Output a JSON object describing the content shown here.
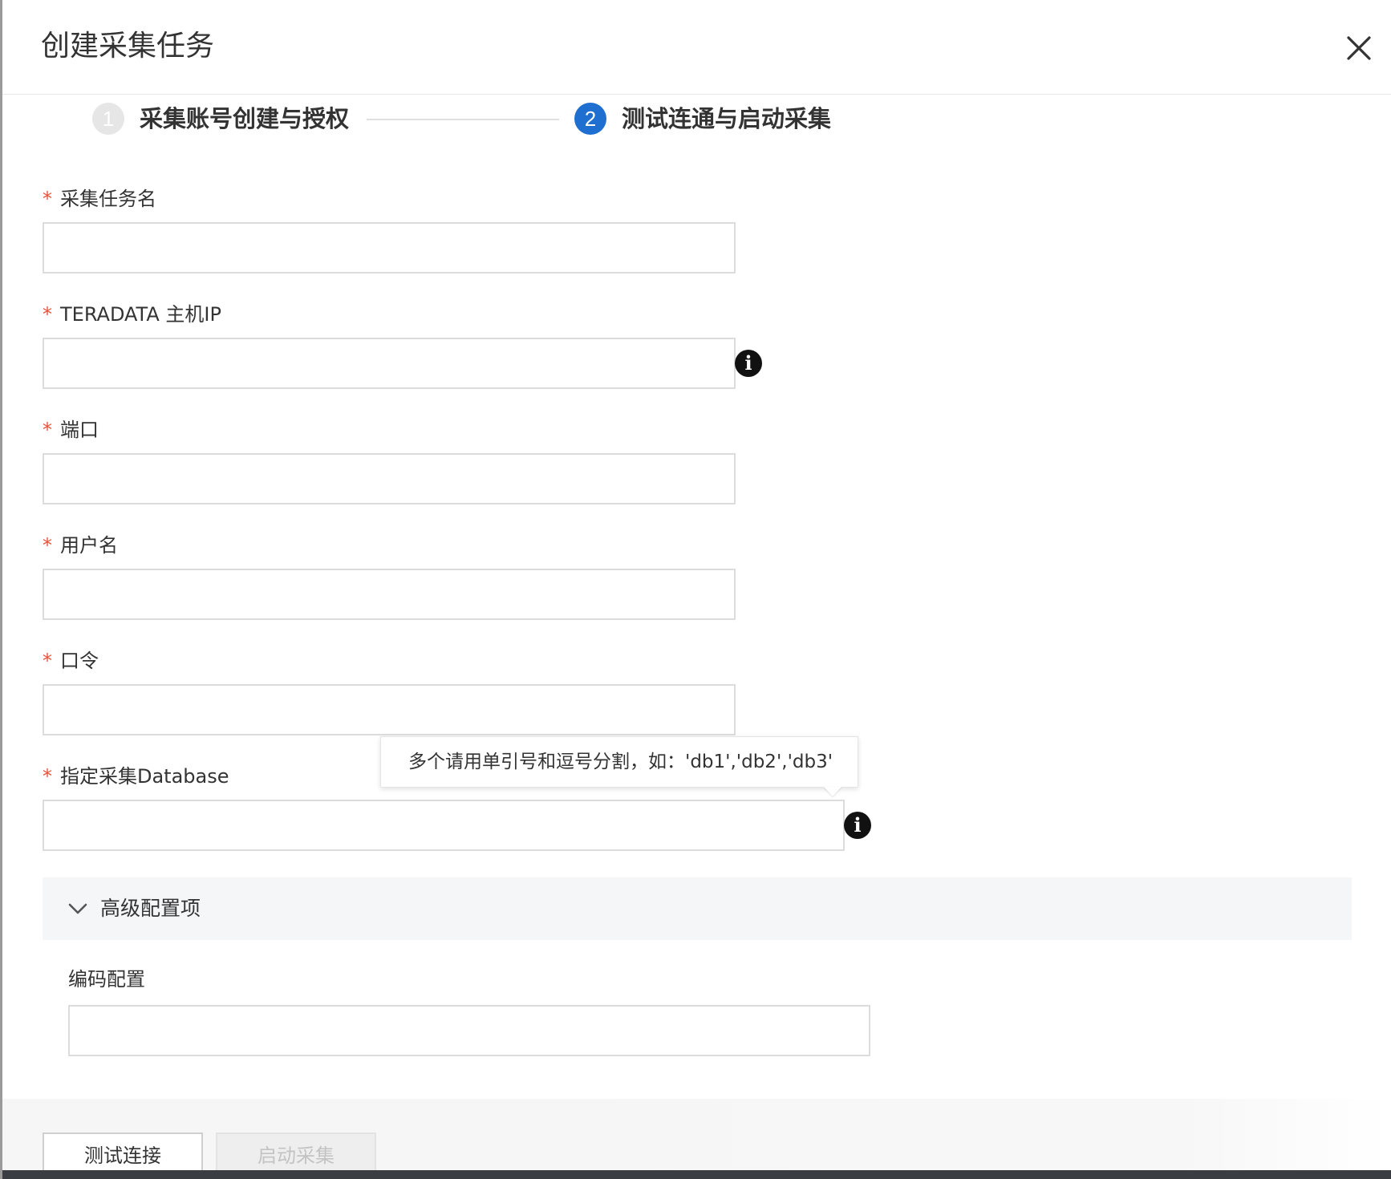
{
  "dialog": {
    "title": "创建采集任务",
    "close_icon": "close-icon"
  },
  "steps": [
    {
      "number": "1",
      "label": "采集账号创建与授权",
      "state": "done"
    },
    {
      "number": "2",
      "label": "测试连通与启动采集",
      "state": "active"
    }
  ],
  "form": {
    "required_mark": "*",
    "task_name": {
      "label": "采集任务名",
      "value": ""
    },
    "host_ip": {
      "label": "TERADATA 主机IP",
      "value": "",
      "info_icon": "info-icon"
    },
    "port": {
      "label": "端口",
      "value": ""
    },
    "username": {
      "label": "用户名",
      "value": ""
    },
    "password": {
      "label": "口令",
      "value": ""
    },
    "database": {
      "label": "指定采集Database",
      "value": "",
      "info_icon": "info-icon"
    }
  },
  "tooltip": {
    "text": "多个请用单引号和逗号分割，如：'db1','db2','db3'"
  },
  "advanced": {
    "label": "高级配置项",
    "expanded": true,
    "encoding": {
      "label": "编码配置",
      "value": ""
    }
  },
  "footer": {
    "test_button": "测试连接",
    "start_button": "启动采集",
    "start_disabled": true
  },
  "colors": {
    "accent": "#1f6fd1",
    "required": "#e8513b",
    "advanced_bg": "#f5f6f8"
  }
}
